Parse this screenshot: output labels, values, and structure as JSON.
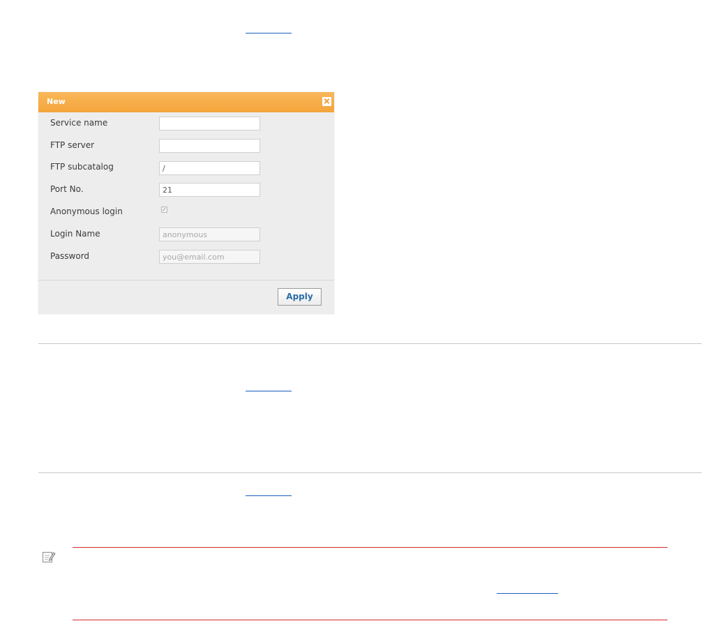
{
  "dialog": {
    "title": "New",
    "fields": [
      {
        "label": "Service name",
        "value": "",
        "placeholder": ""
      },
      {
        "label": "FTP server",
        "value": "",
        "placeholder": ""
      },
      {
        "label": "FTP subcatalog",
        "value": "/",
        "placeholder": ""
      },
      {
        "label": "Port No.",
        "value": "21",
        "placeholder": ""
      }
    ],
    "anonymous_login": {
      "label": "Anonymous login",
      "checked": true,
      "mark": "✓"
    },
    "login_name": {
      "label": "Login Name",
      "placeholder": "anonymous"
    },
    "password": {
      "label": "Password",
      "placeholder": "you@email.com"
    },
    "apply_label": "Apply"
  },
  "colors": {
    "titlebar": "#f5a943",
    "dialog_background": "#ededed",
    "note_rule": "#d22d2d",
    "link": "#1a5fbf",
    "apply_text": "#2b6ea8"
  },
  "icons": {
    "close": "close-icon",
    "note": "note-pencil-icon"
  }
}
